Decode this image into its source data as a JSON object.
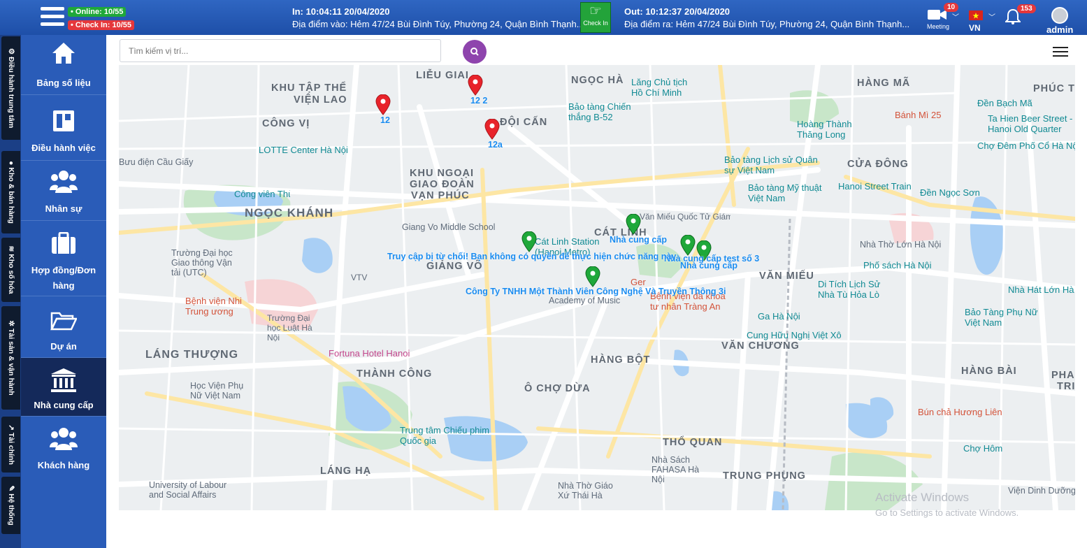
{
  "header": {
    "online_label": "• Online: 10/55",
    "checkin_label": "• Check In: 10/55",
    "in_time": "In: 10:04:11 20/04/2020",
    "in_location": "Địa điểm vào: Hẻm 47/24 Bùi Đình Túy, Phường 24, Quận Bình Thạnh...",
    "checkin_button": "Check In",
    "out_time": "Out: 10:12:37 20/04/2020",
    "out_location": "Địa điểm ra: Hẻm 47/24 Bùi Đình Túy, Phường 24, Quận Bình Thạnh...",
    "meeting_label": "Meeting",
    "meeting_badge": "10",
    "language": "VN",
    "notif_badge": "153",
    "user_name": "admin"
  },
  "vertical_tabs": [
    {
      "label": "Điều hành trung tâm",
      "icon": "gear-icon"
    },
    {
      "label": "Kho & bán hàng",
      "icon": "globe-icon"
    },
    {
      "label": "Kho số hóa",
      "icon": "signal-icon"
    },
    {
      "label": "Tài sản & vận hành",
      "icon": "cogs-icon"
    },
    {
      "label": "Tài chính",
      "icon": "chart-icon"
    },
    {
      "label": "Hệ thống",
      "icon": "edit-icon"
    }
  ],
  "sidebar": {
    "items": [
      {
        "label": "Bảng số liệu",
        "icon": "home-icon"
      },
      {
        "label": "Điều hành việc",
        "icon": "board-icon"
      },
      {
        "label": "Nhân sự",
        "icon": "users-icon"
      },
      {
        "label": "Hợp đồng/Đơn hàng",
        "icon": "briefcase-icon"
      },
      {
        "label": "Dự án",
        "icon": "folder-icon"
      },
      {
        "label": "Nhà cung cấp",
        "icon": "bank-icon"
      },
      {
        "label": "Khách hàng",
        "icon": "users-icon"
      }
    ]
  },
  "search": {
    "placeholder": "Tìm kiếm vị trí..."
  },
  "map": {
    "districts": [
      "LIỄU GIAI",
      "NGỌC HÀ",
      "KHU TẬP THỂ",
      "VIỆN LAO",
      "CÔNG VỊ",
      "ĐỘI CẤN",
      "KHU NGOẠI",
      "GIAO ĐOÀN",
      "VẠN PHÚC",
      "NGỌC KHÁNH",
      "CÁT LINH",
      "GIẢNG VÕ",
      "VĂN MIẾU",
      "LÁNG THƯỢNG",
      "THÀNH CÔNG",
      "HÀNG BỘT",
      "Ô CHỢ DỪA",
      "VĂN CHƯƠNG",
      "HÀNG MÃ",
      "PHÚC T",
      "CỬA ĐÔNG",
      "HÀNG BÀI",
      "PHAN",
      "TRI",
      "LÁNG HẠ",
      "THỔ QUAN",
      "TRUNG PHỤNG"
    ],
    "places": [
      "Lăng Chủ tịch Hồ Chí Minh",
      "Bảo tàng Chiến thắng B-52",
      "Hoàng Thành Thăng Long",
      "Bảo tàng Lịch sử Quân sự Việt Nam",
      "Bảo tàng Mỹ thuật Việt Nam",
      "LOTTE Center Hà Nội",
      "Bưu điện Cầu Giấy",
      "Công viên Thủ Lệ",
      "Giang Vo Middle School",
      "Cát Linh Station (Hanoi Metro)",
      "Trường Đại học Giao thông Vận tải (UTC)",
      "VTV",
      "Bệnh viện Nhi Trung ương",
      "Trường Đại học Luật Hà Nội",
      "Fortuna Hotel Hanoi",
      "Học Viện Phụ Nữ Việt Nam",
      "Trung tâm Chiếu phim Quốc gia",
      "University of Labour and Social Affairs",
      "Nhà Thờ Giáo Xứ Thái Hà",
      "Nhà Sách FAHASA Hà Nội",
      "Văn Miếu Quốc Tử Giám",
      "Bệnh viện đa khoa tư nhân Tràng An",
      "Ga Hà Nội",
      "Cung Hữu Nghị Việt Xô",
      "Di Tích Lịch Sử Nhà Tù Hỏa Lò",
      "Phố sách Hà Nội",
      "Nhà Thờ Lớn Hà Nội",
      "Bảo Tàng Phụ Nữ Việt Nam",
      "Nhà Hát Lớn Hà",
      "Hanoi Street Train",
      "Đền Ngọc Sơn",
      "Đền Bạch Mã",
      "Bánh Mì 25",
      "Ta Hien Beer Street - Hanoi Old Quarter",
      "Chợ Đêm Phố Cổ Hà Nội",
      "Chợ Hôm",
      "Bún chả Hương Liên",
      "Viện Dinh Dưỡng",
      "Ger",
      "Academy of Music"
    ],
    "markers": {
      "red": [
        "12",
        "12 2",
        "12a"
      ],
      "green": [
        "Nhà cung cấp",
        "Nhà cung cấp",
        "Nhà cung cấp test số 3",
        "Công Ty TNHH Một Thành Viên Công Nghệ Và Truyền Thông 3i"
      ],
      "denied_text": "Truy cập bị từ chối! Bạn không có quyền để thực hiện chức năng này"
    }
  },
  "watermark": {
    "line1": "Activate Windows",
    "line2": "Go to Settings to activate Windows."
  },
  "colors": {
    "header": "#2a5cb8",
    "sidebar": "#2a5cb8",
    "sidebar_active": "#14295a",
    "search_button": "#8e44ad",
    "marker_red": "#e8232b",
    "marker_green": "#1fa83a"
  }
}
